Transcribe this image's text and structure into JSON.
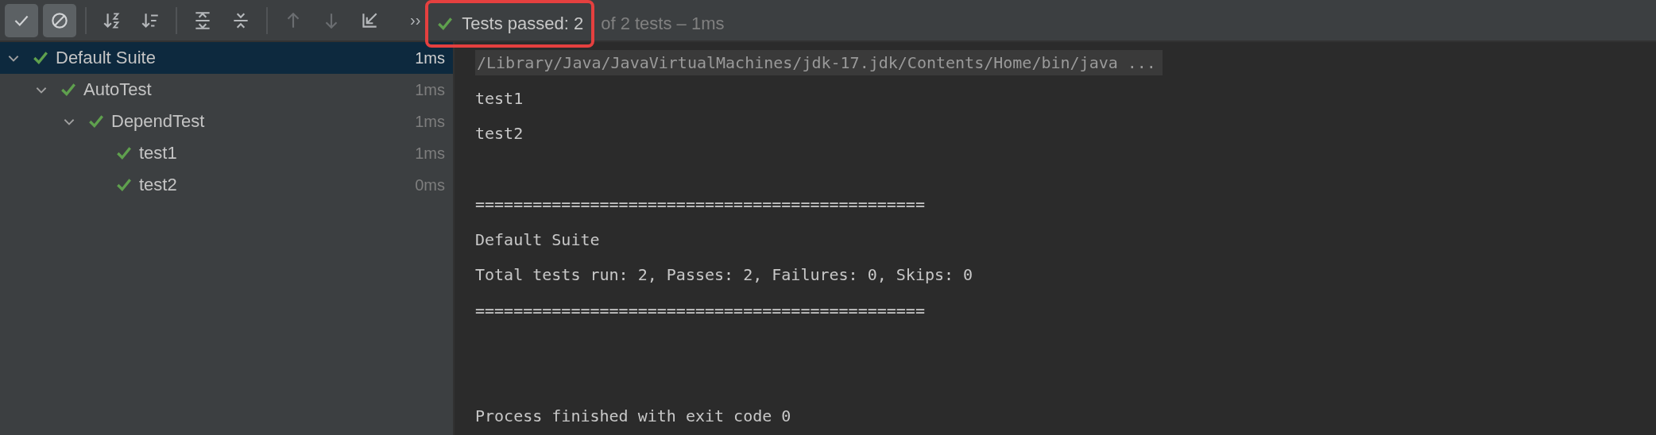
{
  "toolbar": {
    "buttons": [
      {
        "kind": "show-passed",
        "on": true,
        "disabled": false
      },
      {
        "kind": "show-ignored",
        "on": true,
        "disabled": false
      },
      {
        "kind": "separator"
      },
      {
        "kind": "sort-alpha",
        "on": false,
        "disabled": false
      },
      {
        "kind": "sort-duration",
        "on": false,
        "disabled": false
      },
      {
        "kind": "separator"
      },
      {
        "kind": "expand-all",
        "on": false,
        "disabled": false
      },
      {
        "kind": "collapse-all",
        "on": false,
        "disabled": false
      },
      {
        "kind": "separator"
      },
      {
        "kind": "previous",
        "on": false,
        "disabled": true
      },
      {
        "kind": "next",
        "on": false,
        "disabled": true
      },
      {
        "kind": "import",
        "on": false,
        "disabled": false
      }
    ],
    "overflow": "››"
  },
  "status": {
    "passed": "Tests passed: 2",
    "summary": "of 2 tests – 1ms",
    "highlighted": true
  },
  "tree": [
    {
      "name": "Default Suite",
      "duration": "1ms",
      "selected": true,
      "expanded": true,
      "children": [
        {
          "name": "AutoTest",
          "duration": "1ms",
          "selected": false,
          "expanded": true,
          "children": [
            {
              "name": "DependTest",
              "duration": "1ms",
              "selected": false,
              "expanded": true,
              "children": [
                {
                  "name": "test1",
                  "duration": "1ms",
                  "selected": false
                },
                {
                  "name": "test2",
                  "duration": "0ms",
                  "selected": false
                }
              ]
            }
          ]
        }
      ]
    }
  ],
  "console": {
    "lines": [
      {
        "kind": "command",
        "text": "/Library/Java/JavaVirtualMachines/jdk-17.jdk/Contents/Home/bin/java ..."
      },
      {
        "kind": "output",
        "text": "test1"
      },
      {
        "kind": "output",
        "text": "test2"
      },
      {
        "kind": "blank"
      },
      {
        "kind": "output",
        "text": "==============================================="
      },
      {
        "kind": "output",
        "text": "Default Suite"
      },
      {
        "kind": "output",
        "text": "Total tests run: 2, Passes: 2, Failures: 0, Skips: 0"
      },
      {
        "kind": "output",
        "text": "==============================================="
      },
      {
        "kind": "blank"
      },
      {
        "kind": "blank"
      },
      {
        "kind": "output",
        "text": "Process finished with exit code 0"
      }
    ]
  }
}
